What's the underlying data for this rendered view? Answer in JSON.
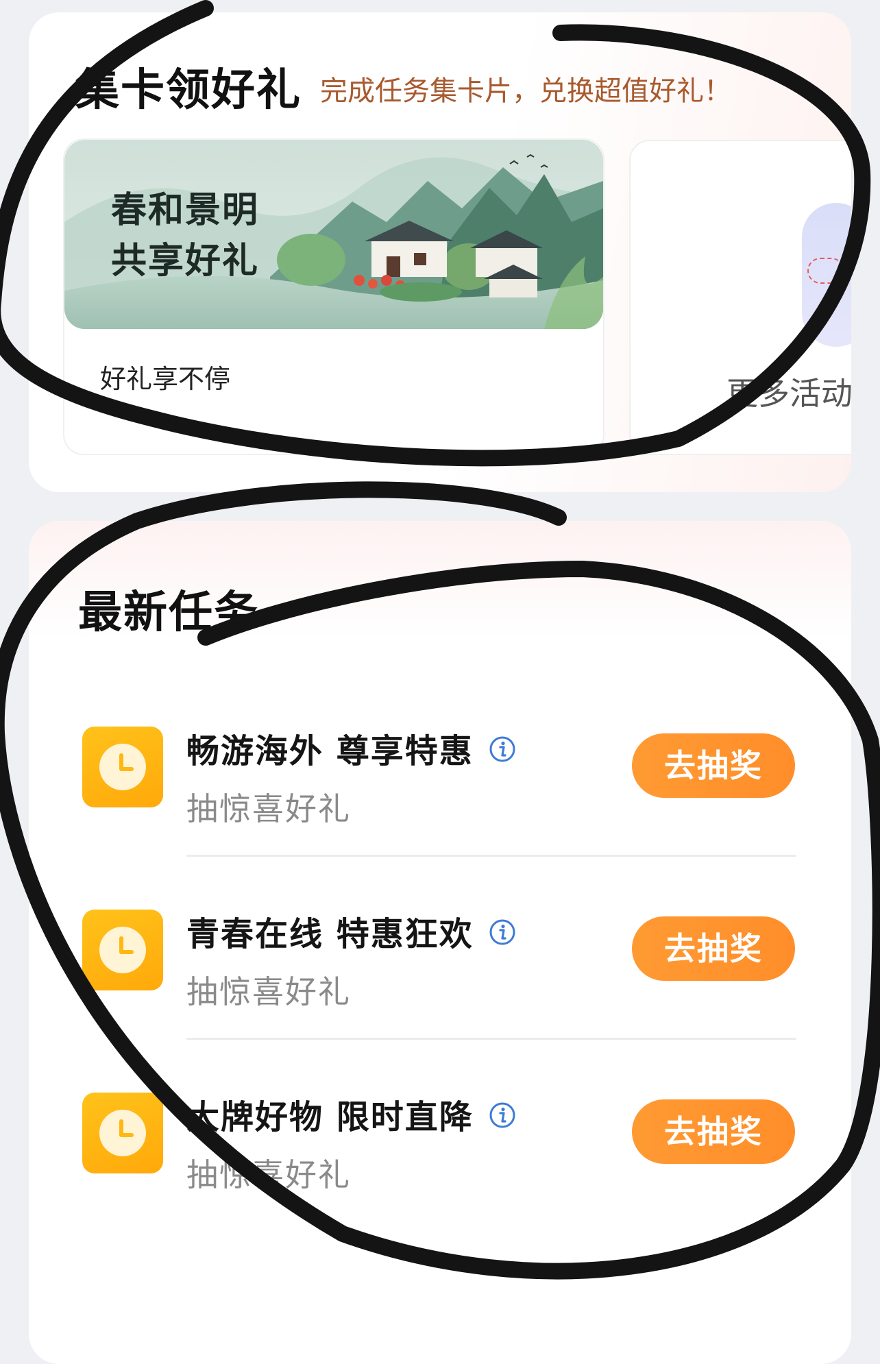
{
  "collect_section": {
    "title": "集卡领好礼",
    "subtitle": "完成任务集卡片，兑换超值好礼！",
    "promo_card": {
      "banner_line1": "春和景明",
      "banner_line2": "共享好礼",
      "caption": "好礼享不停"
    },
    "more_card": {
      "label": "更多活动"
    }
  },
  "tasks_section": {
    "title": "最新任务",
    "items": [
      {
        "title": "畅游海外 尊享特惠",
        "desc": "抽惊喜好礼",
        "button": "去抽奖",
        "icon": "clock-icon"
      },
      {
        "title": "青春在线 特惠狂欢",
        "desc": "抽惊喜好礼",
        "button": "去抽奖",
        "icon": "clock-icon"
      },
      {
        "title": "大牌好物 限时直降",
        "desc": "抽惊喜好礼",
        "button": "去抽奖",
        "icon": "clock-icon"
      }
    ]
  },
  "colors": {
    "accent_orange": "#ff962f",
    "subtitle_brown": "#a85a2e",
    "info_blue": "#3d7bd6",
    "clock_yellow": "#ffb812"
  }
}
